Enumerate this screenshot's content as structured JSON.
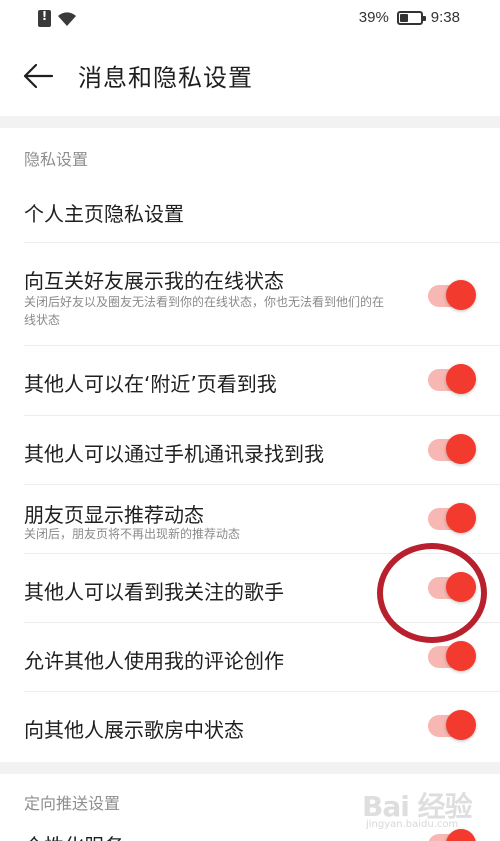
{
  "status_bar": {
    "battery": "39%",
    "time": "9:38"
  },
  "header": {
    "title": "消息和隐私设置"
  },
  "privacy_section": {
    "title": "隐私设置",
    "items": [
      {
        "label": "个人主页隐私设置",
        "desc": "",
        "toggle": false
      },
      {
        "label": "向互关好友展示我的在线状态",
        "desc": "关闭后好友以及圈友无法看到你的在线状态，你也无法看到他们的在线状态",
        "toggle": true,
        "on": true
      },
      {
        "label": "其他人可以在‘附近’页看到我",
        "desc": "",
        "toggle": true,
        "on": true
      },
      {
        "label": "其他人可以通过手机通讯录找到我",
        "desc": "",
        "toggle": true,
        "on": true
      },
      {
        "label": "朋友页显示推荐动态",
        "desc": "关闭后，朋友页将不再出现新的推荐动态",
        "toggle": true,
        "on": true
      },
      {
        "label": "其他人可以看到我关注的歌手",
        "desc": "",
        "toggle": true,
        "on": true
      },
      {
        "label": "允许其他人使用我的评论创作",
        "desc": "",
        "toggle": true,
        "on": true
      },
      {
        "label": "向其他人展示歌房中状态",
        "desc": "",
        "toggle": true,
        "on": true
      }
    ]
  },
  "push_section": {
    "title": "定向推送设置",
    "items": [
      {
        "label": "个性化服务",
        "toggle": true,
        "on": true
      }
    ]
  },
  "watermark": {
    "text": "Bai 经验",
    "sub": "jingyan.baidu.com"
  },
  "colors": {
    "accent": "#f23a2f",
    "track": "#f7b7b2",
    "highlight": "#b8202e"
  }
}
